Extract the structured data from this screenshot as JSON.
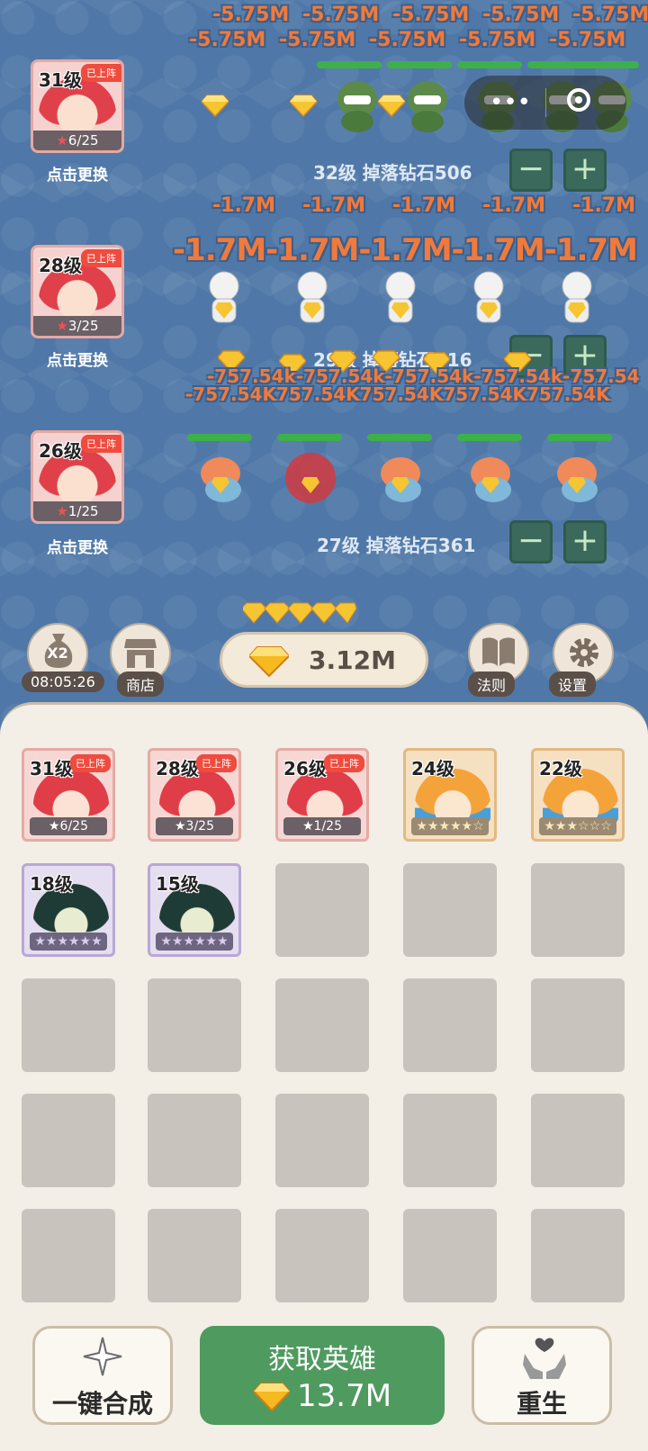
{
  "battle": {
    "damage_row1": [
      "-5.75M",
      "-5.75M",
      "-5.75M",
      "-5.75M",
      "-5.75M"
    ],
    "damage_row1b": [
      "-5.75M",
      "-5.75M",
      "-5.75M",
      "-5.75M",
      "-5.75M"
    ],
    "damage_row2_small": [
      "-1.7M",
      "-1.7M",
      "-1.7M",
      "-1.7M",
      "-1.7M"
    ],
    "damage_row2_big": "-1.7M-1.7M-1.7M-1.7M-1.7M",
    "damage_row3": "-757.54k-757.54k-757.54k-757.54k-757.54",
    "damage_row3b": "-757.54K757.54K757.54K757.54K757.54K",
    "swap_label": "点击更换",
    "lanes": [
      {
        "hero_level": "31级",
        "status": "已上阵",
        "stars": "6/25",
        "info": "32级 掉落钻石506"
      },
      {
        "hero_level": "28级",
        "status": "已上阵",
        "stars": "3/25",
        "info": "29级 掉落钻石416"
      },
      {
        "hero_level": "26级",
        "status": "已上阵",
        "stars": "1/25",
        "info": "27级 掉落钻石361"
      }
    ],
    "minus_label": "−",
    "plus_label": "+"
  },
  "toolbar": {
    "boost_label": "X2",
    "timer": "08:05:26",
    "shop_label": "商店",
    "gem_total": "3.12M",
    "rules_label": "法则",
    "settings_label": "设置"
  },
  "inventory": {
    "cards": [
      {
        "level": "31级",
        "tag": "已上阵",
        "stars": "★6/25",
        "rarity": "red"
      },
      {
        "level": "28级",
        "tag": "已上阵",
        "stars": "★3/25",
        "rarity": "red"
      },
      {
        "level": "26级",
        "tag": "已上阵",
        "stars": "★1/25",
        "rarity": "red"
      },
      {
        "level": "24级",
        "tag": "",
        "stars": "★★★★★☆",
        "rarity": "orange"
      },
      {
        "level": "22级",
        "tag": "",
        "stars": "★★★☆☆☆",
        "rarity": "orange"
      },
      {
        "level": "18级",
        "tag": "",
        "stars": "★★★★★★",
        "rarity": "purple"
      },
      {
        "level": "15级",
        "tag": "",
        "stars": "★★★★★★",
        "rarity": "purple"
      }
    ]
  },
  "actions": {
    "merge_label": "一键合成",
    "recruit_label": "获取英雄",
    "recruit_cost": "13.7M",
    "rebirth_label": "重生"
  },
  "colors": {
    "battle_bg": "#4f78a8",
    "damage": "#f07a3c",
    "hp": "#3db04a",
    "primary_button": "#4f9a5f"
  }
}
